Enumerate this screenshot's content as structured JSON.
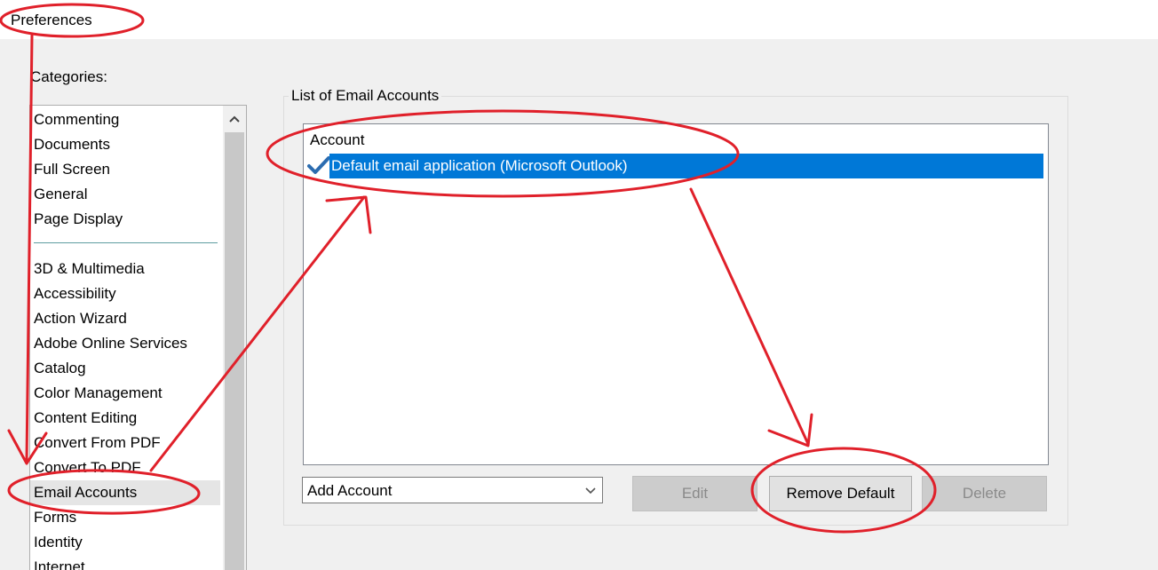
{
  "window": {
    "title": "Preferences"
  },
  "categories": {
    "label": "Categories:",
    "items": [
      "Commenting",
      "Documents",
      "Full Screen",
      "General",
      "Page Display",
      "3D & Multimedia",
      "Accessibility",
      "Action Wizard",
      "Adobe Online Services",
      "Catalog",
      "Color Management",
      "Content Editing",
      "Convert From PDF",
      "Convert To PDF",
      "Email Accounts",
      "Forms",
      "Identity",
      "Internet"
    ],
    "selected": "Email Accounts"
  },
  "email_accounts": {
    "group_label": "List of Email Accounts",
    "column_header": "Account",
    "accounts": [
      {
        "name": "Default email application (Microsoft Outlook)",
        "is_default": true,
        "selected": true
      }
    ],
    "add_account_dropdown": {
      "value": "Add Account"
    },
    "buttons": {
      "edit": "Edit",
      "remove_default": "Remove Default",
      "delete": "Delete"
    }
  },
  "annotations": {
    "color": "#e0202a"
  },
  "icons": {
    "default_check": "checkmark-icon",
    "scroll_up": "chevron-up-icon",
    "dropdown": "chevron-down-icon"
  }
}
